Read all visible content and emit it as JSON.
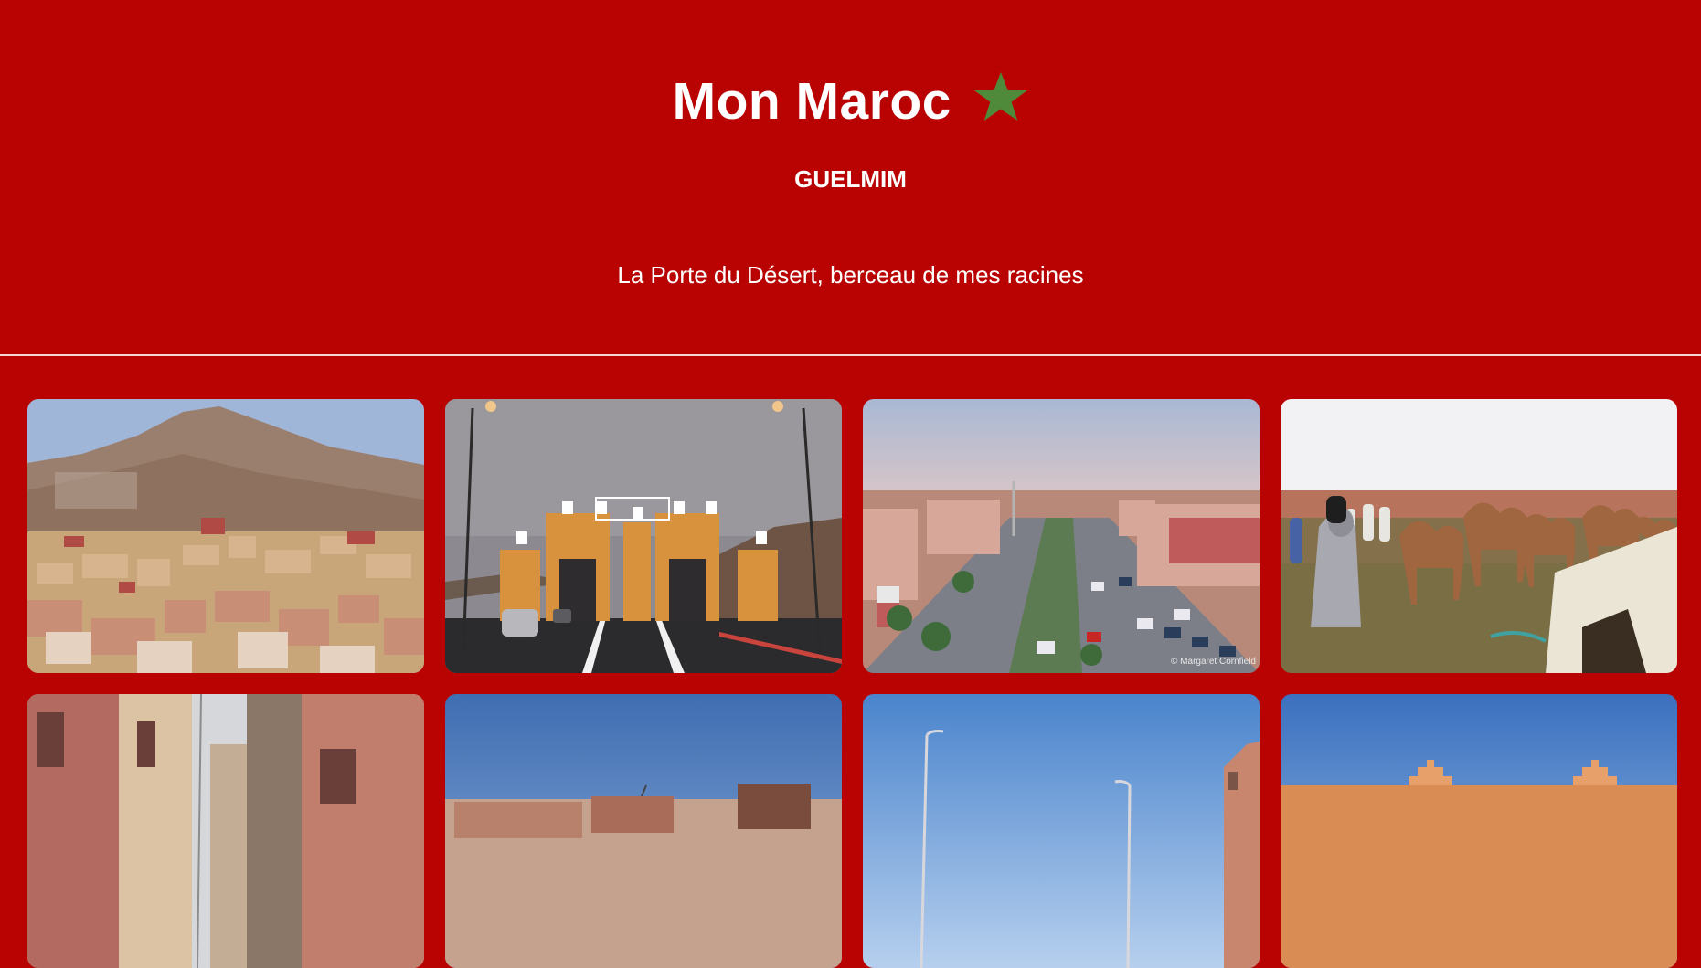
{
  "header": {
    "title": "Mon Maroc",
    "star_icon": "star-icon",
    "star_color": "#4e8a3a",
    "city": "GUELMIM",
    "tagline": "La Porte du Désert, berceau de mes racines"
  },
  "colors": {
    "background": "#b90303",
    "text": "#ffffff",
    "divider": "#f4d6d6"
  },
  "gallery": {
    "photos": [
      {
        "subject": "hillside-town-photo"
      },
      {
        "subject": "city-gate-photo"
      },
      {
        "subject": "avenue-aerial-photo",
        "credit": "© Margaret Cornfield"
      },
      {
        "subject": "camel-market-photo"
      },
      {
        "subject": "old-street-photo"
      },
      {
        "subject": "rooftops-photo"
      },
      {
        "subject": "street-lamps-photo"
      },
      {
        "subject": "desert-wall-photo"
      }
    ]
  }
}
